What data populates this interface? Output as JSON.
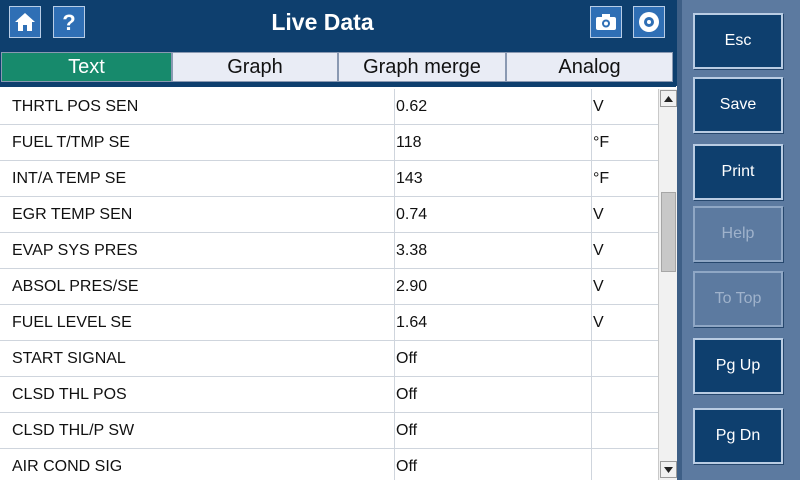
{
  "header": {
    "title": "Live Data"
  },
  "icons": {
    "home": "home-icon",
    "help": "help-icon",
    "camera": "camera-icon",
    "record": "record-icon"
  },
  "tabs": [
    {
      "label": "Text",
      "active": true
    },
    {
      "label": "Graph",
      "active": false
    },
    {
      "label": "Graph merge",
      "active": false
    },
    {
      "label": "Analog",
      "active": false
    }
  ],
  "rows": [
    {
      "name": "THRTL POS SEN",
      "value": "0.62",
      "unit": "V"
    },
    {
      "name": "FUEL T/TMP SE",
      "value": "118",
      "unit": "°F"
    },
    {
      "name": "INT/A TEMP SE",
      "value": "143",
      "unit": "°F"
    },
    {
      "name": "EGR TEMP SEN",
      "value": "0.74",
      "unit": "V"
    },
    {
      "name": "EVAP SYS PRES",
      "value": "3.38",
      "unit": "V"
    },
    {
      "name": "ABSOL PRES/SE",
      "value": "2.90",
      "unit": "V"
    },
    {
      "name": "FUEL LEVEL SE",
      "value": "1.64",
      "unit": "V"
    },
    {
      "name": "START SIGNAL",
      "value": "Off",
      "unit": ""
    },
    {
      "name": "CLSD THL POS",
      "value": "Off",
      "unit": ""
    },
    {
      "name": "CLSD THL/P SW",
      "value": "Off",
      "unit": ""
    },
    {
      "name": "AIR COND SIG",
      "value": "Off",
      "unit": ""
    }
  ],
  "side_buttons": [
    {
      "label": "Esc",
      "enabled": true
    },
    {
      "label": "Save",
      "enabled": true
    },
    {
      "label": "Print",
      "enabled": true
    },
    {
      "label": "Help",
      "enabled": false
    },
    {
      "label": "To Top",
      "enabled": false
    },
    {
      "label": "Pg Up",
      "enabled": true
    },
    {
      "label": "Pg Dn",
      "enabled": true
    }
  ],
  "colors": {
    "header_bg": "#0e3f6e",
    "active_tab": "#178a6c",
    "side_panel": "#5c7aa0"
  }
}
